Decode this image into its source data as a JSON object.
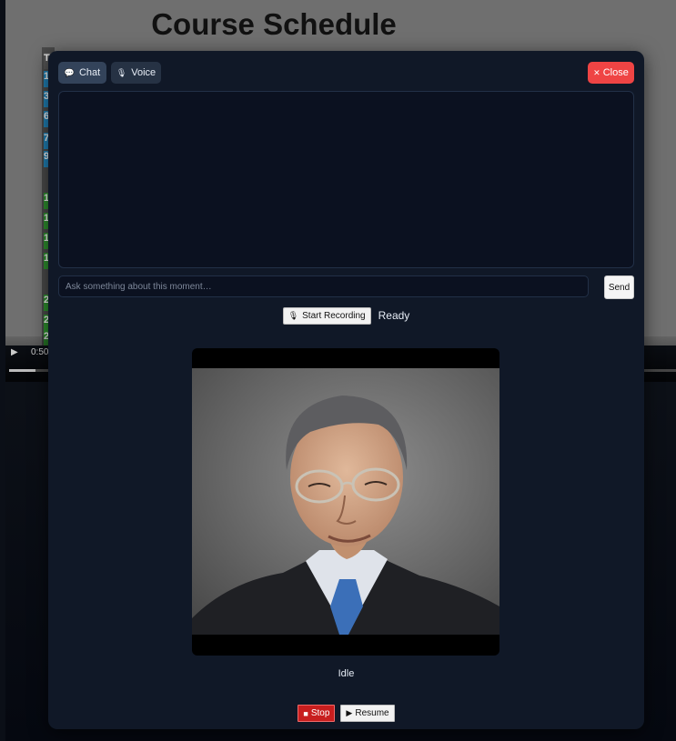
{
  "background": {
    "slide_title": "Course Schedule",
    "table_header_initial": "T",
    "table_row_initials": [
      "1",
      "3",
      "6",
      "7",
      "9",
      "1",
      "1",
      "1",
      "1",
      "2",
      "2",
      "2"
    ],
    "video_time": "0:50",
    "video_progress_fraction": 0.04,
    "play_glyph": "▶"
  },
  "tabs": [
    {
      "label": "Chat",
      "icon": "chat-bubble-icon",
      "glyph": "💬"
    },
    {
      "label": "Voice",
      "icon": "microphone-icon",
      "glyph": "🎙"
    }
  ],
  "close": {
    "label": "Close",
    "glyph": "✕",
    "color": "#ef4444"
  },
  "chat": {
    "input_placeholder": "Ask something about this moment…",
    "input_value": "",
    "send_label": "Send"
  },
  "recording": {
    "button_label": "Start Recording",
    "button_glyph": "🎙",
    "status": "Ready"
  },
  "avatar": {
    "status": "Idle"
  },
  "controls": {
    "stop_label": "Stop",
    "stop_glyph": "■",
    "resume_label": "Resume",
    "resume_glyph": "▶"
  },
  "colors": {
    "panel_bg": "#101827",
    "accent_red": "#ef4444",
    "stop_red": "#c81e1e"
  }
}
